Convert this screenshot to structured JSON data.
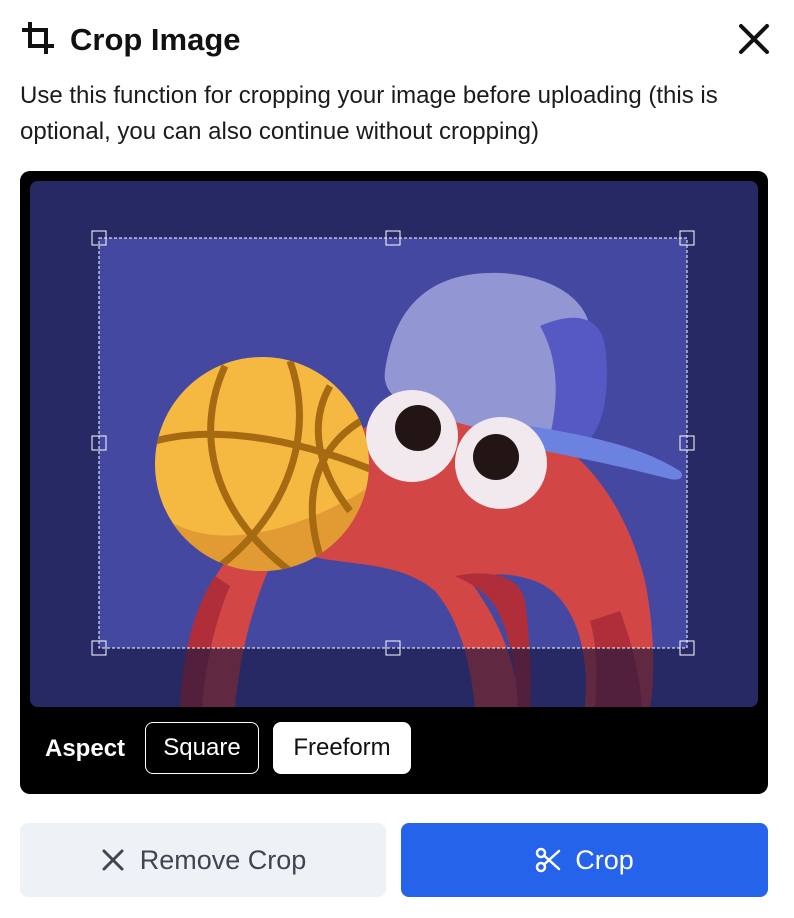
{
  "dialog": {
    "title": "Crop Image",
    "description": "Use this function for cropping your image before uploading (this is optional, you can also continue without cropping)"
  },
  "icons": {
    "title_icon": "crop-icon",
    "close_icon": "close-icon",
    "remove_icon": "x-icon",
    "crop_icon": "scissors-icon"
  },
  "editor": {
    "aspect_label": "Aspect",
    "aspect_options": [
      "Square",
      "Freeform"
    ],
    "selected_aspect": "Freeform"
  },
  "actions": {
    "remove_label": "Remove Crop",
    "crop_label": "Crop"
  },
  "colors": {
    "accent": "#2563eb",
    "secondary_bg": "#eef1f5",
    "image_bg": "#4548a0",
    "image_dim": "#22245a",
    "ball": "#f5b841",
    "creature": "#d24646",
    "cap": "#9296d3"
  }
}
